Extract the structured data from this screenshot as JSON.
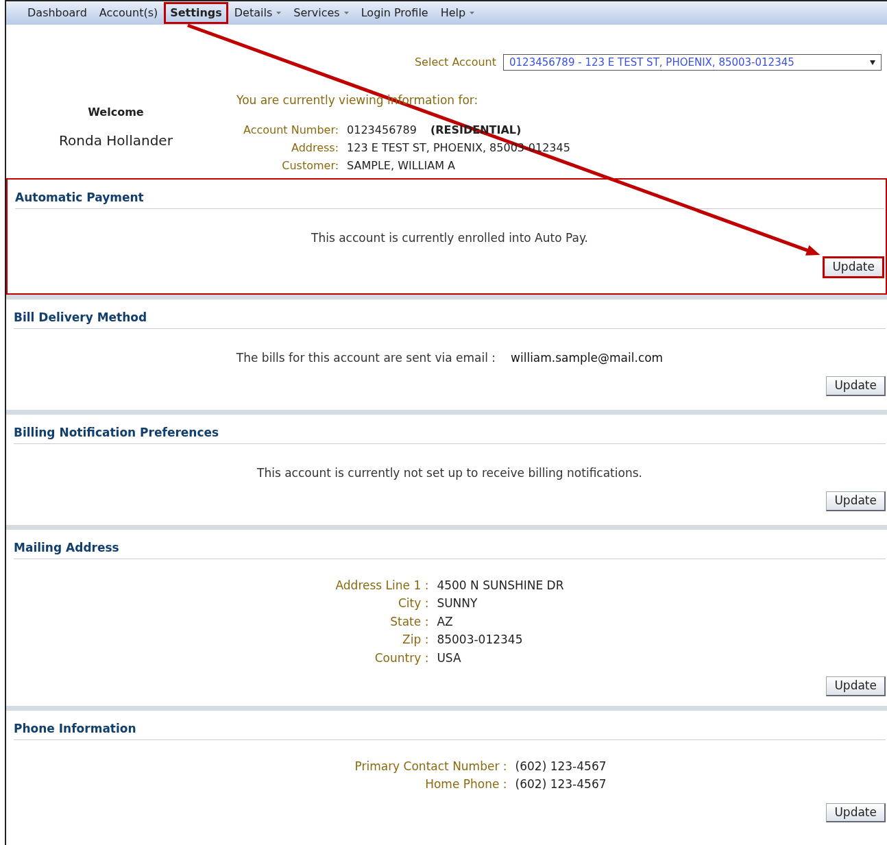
{
  "nav": [
    {
      "label": "Dashboard",
      "dropdown": false,
      "selected": false,
      "highlighted": false
    },
    {
      "label": "Account(s)",
      "dropdown": false,
      "selected": false,
      "highlighted": false
    },
    {
      "label": "Settings",
      "dropdown": false,
      "selected": true,
      "highlighted": true
    },
    {
      "label": "Details",
      "dropdown": true,
      "selected": false,
      "highlighted": false
    },
    {
      "label": "Services",
      "dropdown": true,
      "selected": false,
      "highlighted": false
    },
    {
      "label": "Login Profile",
      "dropdown": false,
      "selected": false,
      "highlighted": false
    },
    {
      "label": "Help",
      "dropdown": true,
      "selected": false,
      "highlighted": false
    }
  ],
  "select_account": {
    "label": "Select Account",
    "value": "0123456789 - 123 E TEST ST, PHOENIX, 85003-012345"
  },
  "welcome": {
    "greeting": "Welcome",
    "name": "Ronda Hollander"
  },
  "account_info": {
    "heading": "You are currently viewing information for:",
    "fields": [
      {
        "label": "Account Number:",
        "value": "0123456789",
        "note": "(RESIDENTIAL)"
      },
      {
        "label": "Address:",
        "value": "123 E TEST ST, PHOENIX, 85003-012345"
      },
      {
        "label": "Customer:",
        "value": "SAMPLE, WILLIAM A"
      }
    ]
  },
  "sections": [
    {
      "title": "Automatic Payment",
      "kind": "message",
      "highlighted": true,
      "message": "This account is currently enrolled into Auto Pay.",
      "button": {
        "label": "Update",
        "highlighted": true
      }
    },
    {
      "title": "Bill Delivery Method",
      "kind": "message",
      "highlighted": false,
      "message": "The bills for this account are sent via email :",
      "value": "william.sample@mail.com",
      "button": {
        "label": "Update",
        "highlighted": false
      }
    },
    {
      "title": "Billing Notification Preferences",
      "kind": "message",
      "highlighted": false,
      "message": "This account is currently not set up to receive billing notifications.",
      "button": {
        "label": "Update",
        "highlighted": false
      }
    },
    {
      "title": "Mailing Address",
      "kind": "fields",
      "highlighted": false,
      "fields": [
        {
          "label": "Address Line 1 :",
          "value": "4500 N SUNSHINE DR"
        },
        {
          "label": "City :",
          "value": "SUNNY"
        },
        {
          "label": "State :",
          "value": "AZ"
        },
        {
          "label": "Zip :",
          "value": "85003-012345"
        },
        {
          "label": "Country :",
          "value": "USA"
        }
      ],
      "button": {
        "label": "Update",
        "highlighted": false
      }
    },
    {
      "title": "Phone Information",
      "kind": "fields",
      "highlighted": false,
      "fields": [
        {
          "label": "Primary Contact Number :",
          "value": "(602) 123-4567"
        },
        {
          "label": "Home Phone :",
          "value": "(602) 123-4567"
        }
      ],
      "button": {
        "label": "Update",
        "highlighted": false
      }
    }
  ],
  "annotation_arrow": true
}
